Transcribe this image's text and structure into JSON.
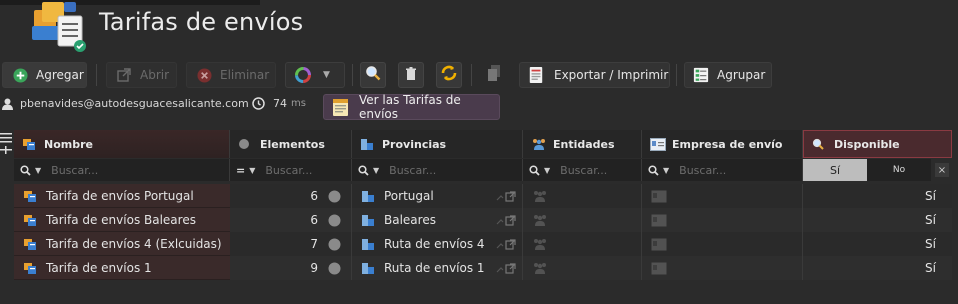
{
  "page_title": "Tarifas de envíos",
  "toolbar": {
    "agregar": "Agregar",
    "abrir": "Abrir",
    "eliminar": "Eliminar",
    "exportar": "Exportar / Imprimir",
    "agrupar": "Agrupar"
  },
  "info": {
    "user_email": "pbenavides@autodesguacesalicante.com",
    "time_value": "74",
    "time_unit": "ms",
    "tarifas_button": "Ver las Tarifas de envíos"
  },
  "grid": {
    "columns": [
      {
        "key": "nombre",
        "label": "Nombre",
        "icon": "tariff-icon"
      },
      {
        "key": "elementos",
        "label": "Elementos",
        "icon": "circle-icon"
      },
      {
        "key": "provincias",
        "label": "Provincias",
        "icon": "buildings-icon"
      },
      {
        "key": "entidades",
        "label": "Entidades",
        "icon": "people-icon"
      },
      {
        "key": "empresa",
        "label": "Empresa de envío",
        "icon": "card-icon"
      },
      {
        "key": "disponible",
        "label": "Disponible",
        "icon": "search-icon"
      }
    ],
    "filter_placeholder": "Buscar...",
    "toggle": {
      "yes": "Sí",
      "no": "No",
      "clear": "×"
    },
    "rows": [
      {
        "nombre": "Tarifa de envíos Portugal",
        "elementos": "6",
        "provincia": "Portugal",
        "disponible": "Sí"
      },
      {
        "nombre": "Tarifa de envíos Baleares",
        "elementos": "6",
        "provincia": "Baleares",
        "disponible": "Sí"
      },
      {
        "nombre": "Tarifa de envíos 4 (Exlcuidas)",
        "elementos": "7",
        "provincia": "Ruta de envíos 4",
        "disponible": "Sí"
      },
      {
        "nombre": "Tarifa de envíos 1",
        "elementos": "9",
        "provincia": "Ruta de envíos 1",
        "disponible": "Sí"
      }
    ]
  },
  "colors": {
    "background": "#2b2b2b",
    "accent_green": "#3aa55a",
    "disabled_red": "#a23a3a",
    "yellow": "#f0b000",
    "disponible_header": "#4a2a2e",
    "tarifas_button": "#4a3b4c"
  }
}
